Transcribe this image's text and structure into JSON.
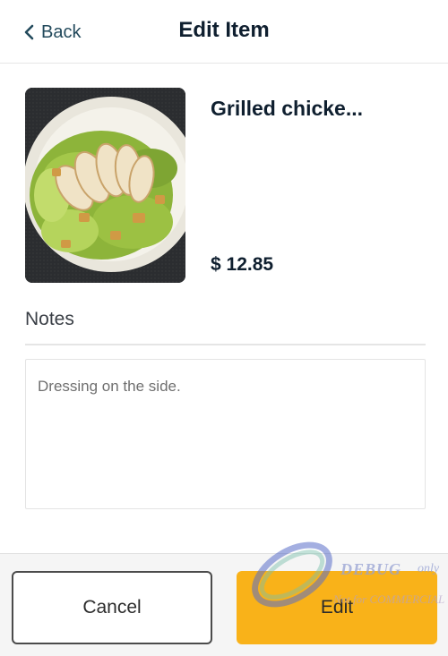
{
  "header": {
    "back_label": "Back",
    "title": "Edit Item"
  },
  "item": {
    "name": "Grilled chicke...",
    "price": "$ 12.85",
    "image_icon": "grilled-chicken-salad-photo"
  },
  "notes": {
    "label": "Notes",
    "value": "Dressing on the side."
  },
  "actions": {
    "cancel_label": "Cancel",
    "edit_label": "Edit"
  },
  "watermark": {
    "line1": "DEBUG",
    "line1_suffix": "only",
    "line2": "Not for COMMERCIAL"
  },
  "colors": {
    "accent": "#f9b219",
    "text_primary": "#0f1f2f",
    "back_link": "#234a5c"
  }
}
